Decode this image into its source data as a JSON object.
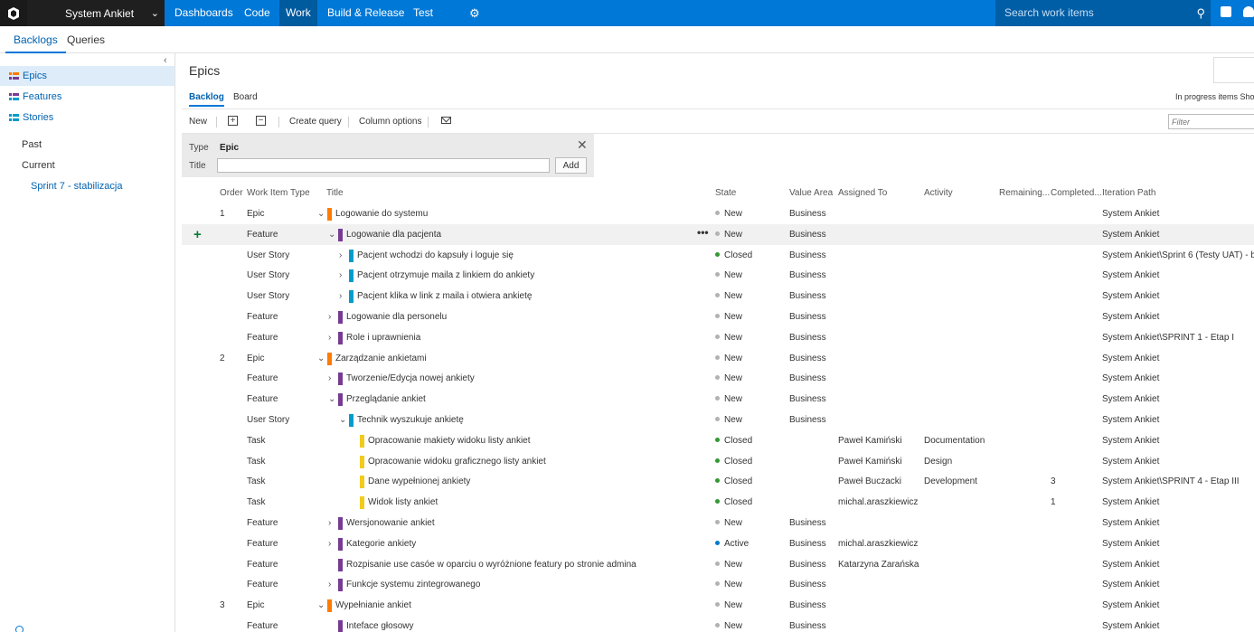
{
  "topbar": {
    "project": "System Ankiet",
    "nav": [
      "Dashboards",
      "Code",
      "Work",
      "Build & Release",
      "Test"
    ],
    "search_placeholder": "Search work items"
  },
  "subtabs": {
    "backlogs": "Backlogs",
    "queries": "Queries"
  },
  "sidebar": {
    "items": [
      "Epics",
      "Features",
      "Stories"
    ],
    "past": "Past",
    "current": "Current",
    "sprint": "Sprint 7 - stabilizacja"
  },
  "main": {
    "title": "Epics",
    "view_tabs": {
      "backlog": "Backlog",
      "board": "Board"
    },
    "in_progress": "In progress items  Sho",
    "toolbar": {
      "new": "New",
      "create_query": "Create query",
      "column_options": "Column options"
    },
    "filter_placeholder": "Filter",
    "add_panel": {
      "type_label": "Type",
      "type_value": "Epic",
      "title_label": "Title",
      "add_button": "Add"
    }
  },
  "columns": [
    "Order",
    "Work Item Type",
    "Title",
    "State",
    "Value Area",
    "Assigned To",
    "Activity",
    "Remaining...",
    "Completed...",
    "Iteration Path"
  ],
  "colors": {
    "Epic": "#ff7b00",
    "Feature": "#773b93",
    "User Story": "#009ccc",
    "Task": "#f2cb1d",
    "state_New": "#b2b2b2",
    "state_Closed": "#339933",
    "state_Active": "#007acc"
  },
  "rows": [
    {
      "order": "1",
      "type": "Epic",
      "caret": "⌄",
      "title": "Logowanie do systemu",
      "state": "New",
      "area": "Business",
      "assigned": "",
      "activity": "",
      "completed": "",
      "path": "System Ankiet"
    },
    {
      "order": "",
      "type": "Feature",
      "caret": "⌄",
      "title": "Logowanie dla pacjenta",
      "state": "New",
      "area": "Business",
      "assigned": "",
      "activity": "",
      "completed": "",
      "path": "System Ankiet",
      "highlight": true
    },
    {
      "order": "",
      "type": "User Story",
      "caret": "›",
      "title": "Pacjent wchodzi do kapsuły i loguje się",
      "state": "Closed",
      "area": "Business",
      "assigned": "",
      "activity": "",
      "completed": "",
      "path": "System Ankiet\\Sprint 6 (Testy UAT) - b"
    },
    {
      "order": "",
      "type": "User Story",
      "caret": "›",
      "title": "Pacjent otrzymuje maila z linkiem do ankiety",
      "state": "New",
      "area": "Business",
      "assigned": "",
      "activity": "",
      "completed": "",
      "path": "System Ankiet"
    },
    {
      "order": "",
      "type": "User Story",
      "caret": "›",
      "title": "Pacjent klika w link z maila i otwiera ankietę",
      "state": "New",
      "area": "Business",
      "assigned": "",
      "activity": "",
      "completed": "",
      "path": "System Ankiet"
    },
    {
      "order": "",
      "type": "Feature",
      "caret": "›",
      "title": "Logowanie dla personelu",
      "state": "New",
      "area": "Business",
      "assigned": "",
      "activity": "",
      "completed": "",
      "path": "System Ankiet"
    },
    {
      "order": "",
      "type": "Feature",
      "caret": "›",
      "title": "Role i uprawnienia",
      "state": "New",
      "area": "Business",
      "assigned": "",
      "activity": "",
      "completed": "",
      "path": "System Ankiet\\SPRINT 1 - Etap I"
    },
    {
      "order": "2",
      "type": "Epic",
      "caret": "⌄",
      "title": "Zarządzanie ankietami",
      "state": "New",
      "area": "Business",
      "assigned": "",
      "activity": "",
      "completed": "",
      "path": "System Ankiet"
    },
    {
      "order": "",
      "type": "Feature",
      "caret": "›",
      "title": "Tworzenie/Edycja nowej ankiety",
      "state": "New",
      "area": "Business",
      "assigned": "",
      "activity": "",
      "completed": "",
      "path": "System Ankiet"
    },
    {
      "order": "",
      "type": "Feature",
      "caret": "⌄",
      "title": "Przeglądanie ankiet",
      "state": "New",
      "area": "Business",
      "assigned": "",
      "activity": "",
      "completed": "",
      "path": "System Ankiet"
    },
    {
      "order": "",
      "type": "User Story",
      "caret": "⌄",
      "title": "Technik wyszukuje ankietę",
      "state": "New",
      "area": "Business",
      "assigned": "",
      "activity": "",
      "completed": "",
      "path": "System Ankiet"
    },
    {
      "order": "",
      "type": "Task",
      "caret": "",
      "title": "Opracowanie makiety widoku listy ankiet",
      "state": "Closed",
      "area": "",
      "assigned": "Paweł Kamiński",
      "activity": "Documentation",
      "completed": "",
      "path": "System Ankiet"
    },
    {
      "order": "",
      "type": "Task",
      "caret": "",
      "title": "Opracowanie widoku graficznego listy ankiet",
      "state": "Closed",
      "area": "",
      "assigned": "Paweł Kamiński",
      "activity": "Design",
      "completed": "",
      "path": "System Ankiet"
    },
    {
      "order": "",
      "type": "Task",
      "caret": "",
      "title": "Dane wypełnionej ankiety",
      "state": "Closed",
      "area": "",
      "assigned": "Paweł Buczacki",
      "activity": "Development",
      "completed": "3",
      "path": "System Ankiet\\SPRINT 4 - Etap III"
    },
    {
      "order": "",
      "type": "Task",
      "caret": "",
      "title": "Widok listy ankiet",
      "state": "Closed",
      "area": "",
      "assigned": "michal.araszkiewicz",
      "activity": "",
      "completed": "1",
      "path": "System Ankiet"
    },
    {
      "order": "",
      "type": "Feature",
      "caret": "›",
      "title": "Wersjonowanie ankiet",
      "state": "New",
      "area": "Business",
      "assigned": "",
      "activity": "",
      "completed": "",
      "path": "System Ankiet"
    },
    {
      "order": "",
      "type": "Feature",
      "caret": "›",
      "title": "Kategorie ankiety",
      "state": "Active",
      "area": "Business",
      "assigned": "michal.araszkiewicz",
      "activity": "",
      "completed": "",
      "path": "System Ankiet"
    },
    {
      "order": "",
      "type": "Feature",
      "caret": "",
      "title": "Rozpisanie use casóe w oparciu o wyróżnione featury po stronie admina",
      "state": "New",
      "area": "Business",
      "assigned": "Katarzyna Zarańska",
      "activity": "",
      "completed": "",
      "path": "System Ankiet"
    },
    {
      "order": "",
      "type": "Feature",
      "caret": "›",
      "title": "Funkcje systemu zintegrowanego",
      "state": "New",
      "area": "Business",
      "assigned": "",
      "activity": "",
      "completed": "",
      "path": "System Ankiet"
    },
    {
      "order": "3",
      "type": "Epic",
      "caret": "⌄",
      "title": "Wypełnianie ankiet",
      "state": "New",
      "area": "Business",
      "assigned": "",
      "activity": "",
      "completed": "",
      "path": "System Ankiet"
    },
    {
      "order": "",
      "type": "Feature",
      "caret": "",
      "title": "Inteface głosowy",
      "state": "New",
      "area": "Business",
      "assigned": "",
      "activity": "",
      "completed": "",
      "path": "System Ankiet"
    }
  ]
}
